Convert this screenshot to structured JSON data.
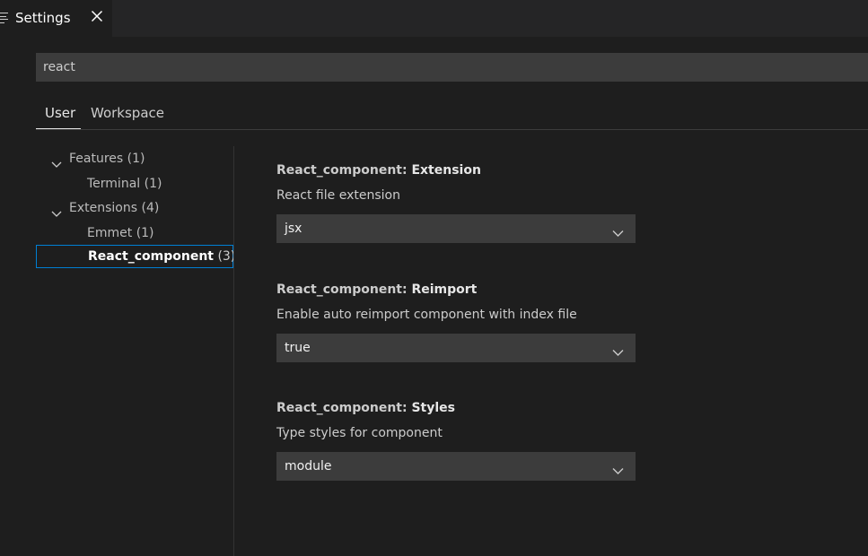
{
  "editor": {
    "tab_label": "Settings"
  },
  "search": {
    "value": "react"
  },
  "scope_tabs": {
    "user": "User",
    "workspace": "Workspace"
  },
  "toc": {
    "features": {
      "label": "Features",
      "count": "(1)"
    },
    "terminal": {
      "label": "Terminal",
      "count": "(1)"
    },
    "extensions": {
      "label": "Extensions",
      "count": "(4)"
    },
    "emmet": {
      "label": "Emmet",
      "count": "(1)"
    },
    "react_component": {
      "label": "React_component",
      "count": "(3)"
    }
  },
  "settings": [
    {
      "category": "React_component: ",
      "key": "Extension",
      "description": "React file extension",
      "value": "jsx"
    },
    {
      "category": "React_component: ",
      "key": "Reimport",
      "description": "Enable auto reimport component with index file",
      "value": "true"
    },
    {
      "category": "React_component: ",
      "key": "Styles",
      "description": "Type styles for component",
      "value": "module"
    }
  ],
  "colors": {
    "background": "#1e1e1e",
    "input_background": "#3c3c3c",
    "focus_border": "#007fd4"
  }
}
